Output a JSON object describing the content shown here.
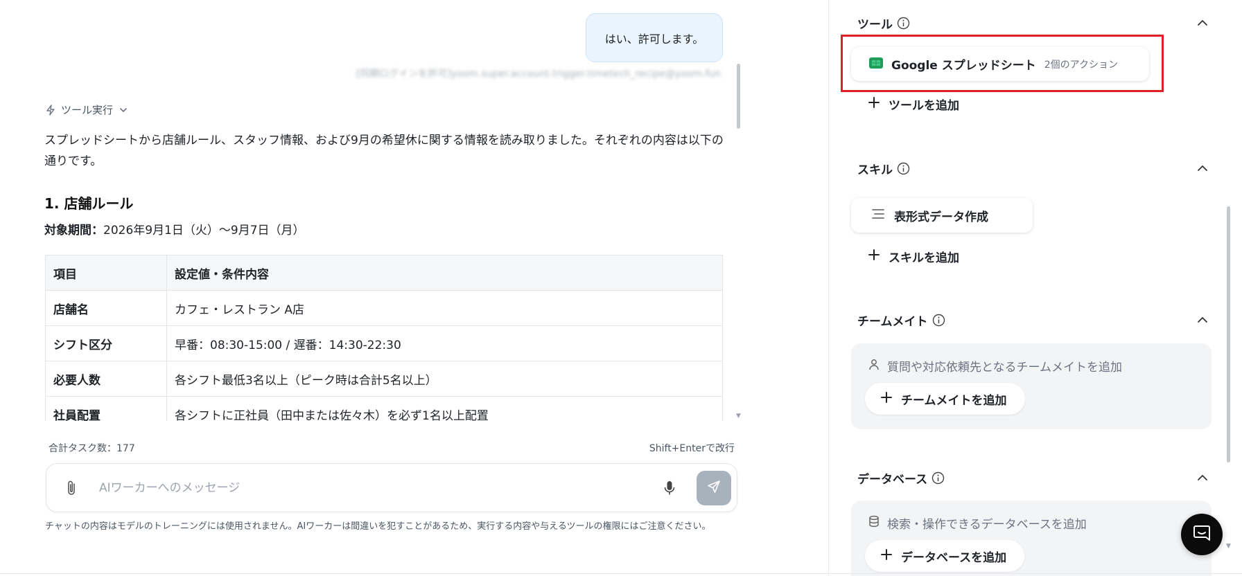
{
  "chat": {
    "user_message": "はい、許可します。",
    "user_meta": "[同期ログインを許可]yoom.super.account.trigger.timetech_recipe@yoom.fun",
    "tool_run_label": "ツール実行",
    "ai_intro": "スプレッドシートから店舗ルール、スタッフ情報、および9月の希望休に関する情報を読み取りました。それぞれの内容は以下の通りです。",
    "section_title": "1. 店舗ルール",
    "period_label": "対象期間：",
    "period_value": "2026年9月1日（火）〜9月7日（月）",
    "table": {
      "headers": [
        "項目",
        "設定値・条件内容"
      ],
      "rows": [
        [
          "店舗名",
          "カフェ・レストラン A店"
        ],
        [
          "シフト区分",
          "早番：08:30-15:00 / 遅番：14:30-22:30"
        ],
        [
          "必要人数",
          "各シフト最低3名以上（ピーク時は合計5名以上）"
        ],
        [
          "社員配置",
          "各シフトに正社員（田中または佐々木）を必ず1名以上配置"
        ]
      ]
    },
    "task_count": "合計タスク数：177",
    "newline_hint": "Shift+Enterで改行",
    "input_placeholder": "AIワーカーへのメッセージ",
    "disclaimer": "チャットの内容はモデルのトレーニングには使用されません。AIワーカーは間違いを犯すことがあるため、実行する内容や与えるツールの権限にはご注意ください。"
  },
  "panel": {
    "tools": {
      "title": "ツール",
      "card_name": "Google スプレッドシート",
      "card_actions": "2個のアクション",
      "add_label": "ツールを追加"
    },
    "skills": {
      "title": "スキル",
      "card_name": "表形式データ作成",
      "add_label": "スキルを追加"
    },
    "teammates": {
      "title": "チームメイト",
      "description": "質問や対応依頼先となるチームメイトを追加",
      "add_label": "チームメイトを追加"
    },
    "database": {
      "title": "データベース",
      "description": "検索・操作できるデータベースを追加",
      "add_label": "データベースを追加"
    }
  },
  "colors": {
    "highlight_border": "#e21f26",
    "user_bubble_bg": "#eaf4fd",
    "send_button_bg": "#a8b2bd",
    "sheets_green": "#1e9e5a"
  },
  "icons": [
    "lightning-icon",
    "chevron-down-icon",
    "paperclip-icon",
    "microphone-icon",
    "send-icon",
    "info-icon",
    "chevron-up-icon",
    "google-sheets-icon",
    "plus-icon",
    "align-left-icon",
    "person-icon",
    "database-icon",
    "chat-bubble-icon"
  ]
}
